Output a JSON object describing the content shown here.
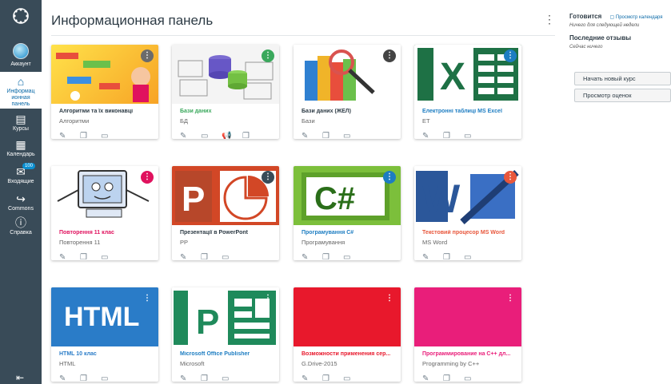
{
  "nav": {
    "account": "Аккаунт",
    "dashboard": "Информац ионная панель",
    "courses": "Курсы",
    "calendar": "Календарь",
    "inbox": "Входящие",
    "inbox_badge": "100",
    "commons": "Commons",
    "help": "Справка"
  },
  "header": {
    "title": "Информационная панель"
  },
  "cards": [
    {
      "title": "Алгоритми та їх виконавці",
      "subtitle": "Алгоритми",
      "color": "#6b6b6b"
    },
    {
      "title": "Бази даних",
      "subtitle": "БД",
      "color": "#3aa85c"
    },
    {
      "title": "Бази даних (ЖЕЛ)",
      "subtitle": "Бази",
      "color": "#444444"
    },
    {
      "title": "Електронні таблиці MS Excel",
      "subtitle": "ET",
      "color": "#1d7dc2"
    },
    {
      "title": "Повторення 11 клас",
      "subtitle": "Повторення 11",
      "color": "#e0125e"
    },
    {
      "title": "Презентації в PowerPont",
      "subtitle": "PP",
      "color": "#394b58"
    },
    {
      "title": "Програмування С#",
      "subtitle": "Програмування",
      "color": "#1d7dc2"
    },
    {
      "title": "Текстовий процесор MS Word",
      "subtitle": "MS Word",
      "color": "#e8573c"
    },
    {
      "title": "HTML 10 клас",
      "subtitle": "HTML",
      "color": "#2a7cc8"
    },
    {
      "title": "Microsoft Office Publisher",
      "subtitle": "Microsoft",
      "color": "#1f8a5b"
    },
    {
      "title": "Возможности применения сер...",
      "subtitle": "G.Drive-2015",
      "color": "#e8182c"
    },
    {
      "title": "Программирование на С++ дл...",
      "subtitle": "Programming by C++",
      "color": "#e91e7a"
    }
  ],
  "sidebar": {
    "todo_heading": "Готовится",
    "calendar_link": "Просмотр календаря",
    "todo_note": "Ничего для следующей недели",
    "feedback_heading": "Последние отзывы",
    "feedback_note": "Сейчас ничего",
    "new_course_button": "Начать новый курс",
    "grades_button": "Просмотр оценок"
  },
  "colors": {
    "nav_bg": "#394b58",
    "link": "#0b6aa8"
  }
}
